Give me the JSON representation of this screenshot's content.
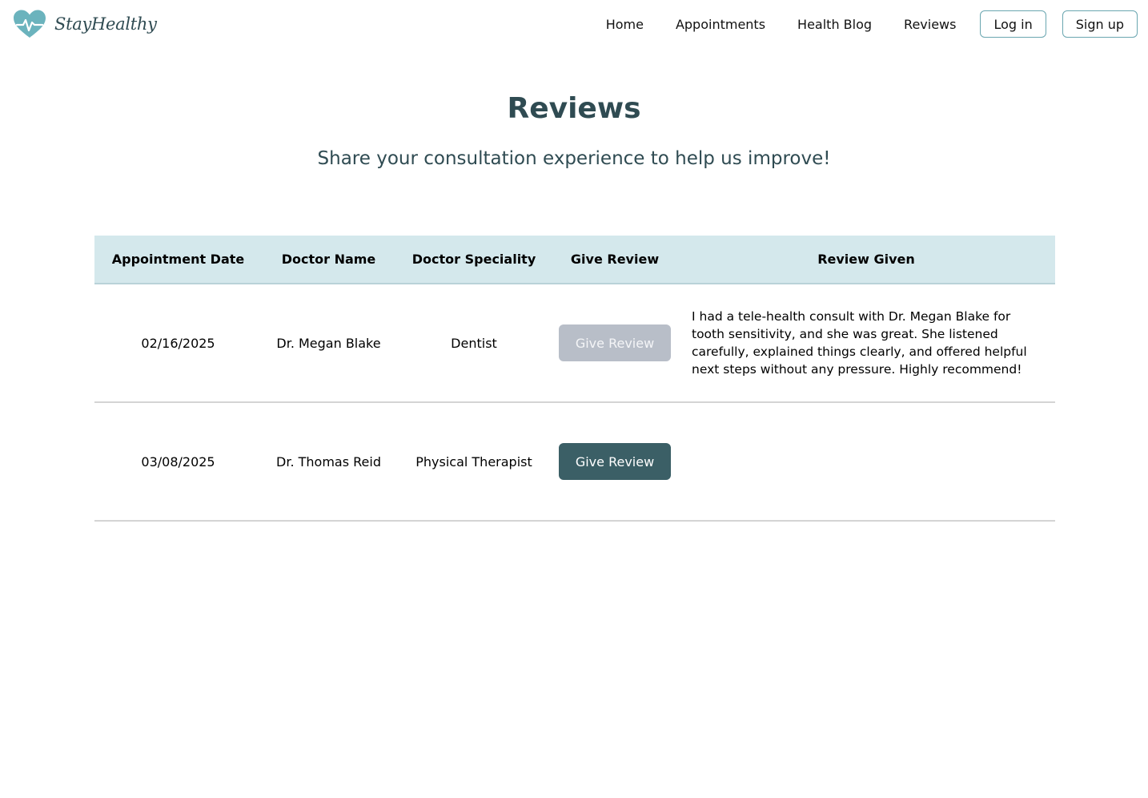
{
  "app": {
    "brand_name": "StayHealthy",
    "brand_color": "#6bb3bd",
    "title_color": "#2f4b52"
  },
  "nav": {
    "links": [
      {
        "label": "Home",
        "icon": null
      },
      {
        "label": "Appointments",
        "icon": null
      },
      {
        "label": "Health Blog",
        "icon": null
      },
      {
        "label": "Reviews",
        "icon": null
      }
    ],
    "login_label": "Log in",
    "signup_label": "Sign up"
  },
  "header": {
    "title": "Reviews",
    "subtitle": "Share your consultation experience to help us improve!"
  },
  "table": {
    "columns": [
      "Appointment Date",
      "Doctor Name",
      "Doctor Speciality",
      "Give Review",
      "Review Given"
    ],
    "header_bg": "#d4e8ec",
    "rows": [
      {
        "date": "02/16/2025",
        "doctor": "Dr. Megan Blake",
        "speciality": "Dentist",
        "button_label": "Give Review",
        "button_state": "disabled",
        "review": "I had a tele-health consult with Dr. Megan Blake for tooth sensitivity, and she was great. She listened carefully, explained things clearly, and offered helpful next steps without any pressure. Highly recommend!"
      },
      {
        "date": "03/08/2025",
        "doctor": "Dr. Thomas Reid",
        "speciality": "Physical Therapist",
        "button_label": "Give Review",
        "button_state": "active",
        "review": ""
      }
    ],
    "colors": {
      "button_active": "#3b5f66",
      "button_disabled": "#b8bec8"
    }
  }
}
